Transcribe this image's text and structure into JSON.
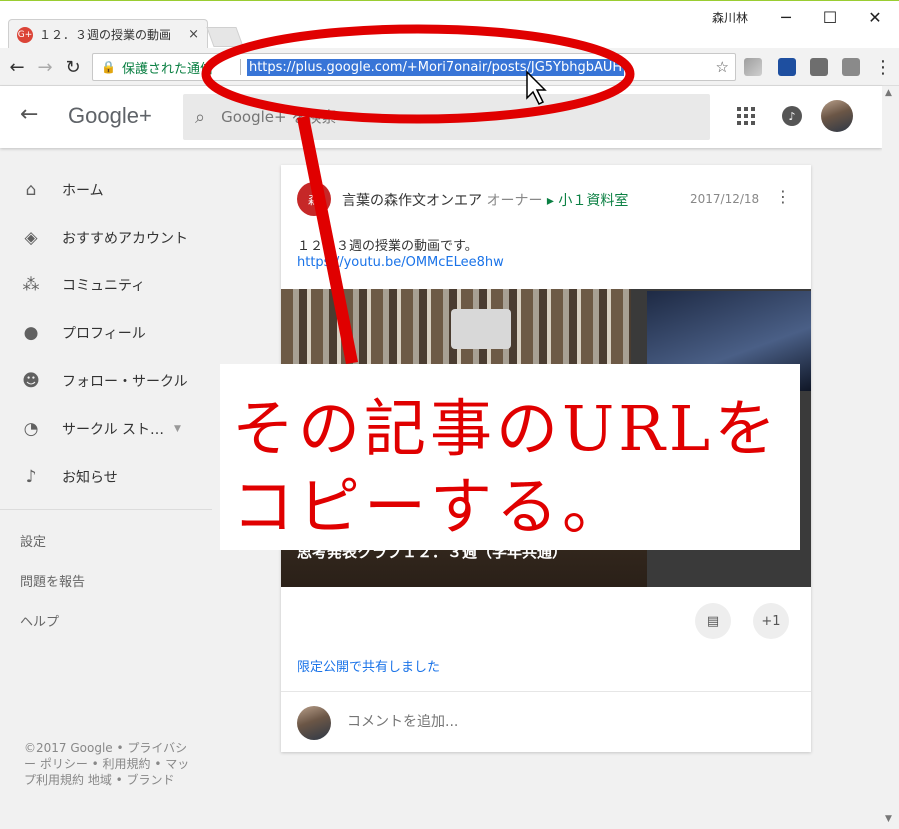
{
  "browser": {
    "tab_title": "１２．３週の授業の動画",
    "tab_close": "×",
    "user": "森川林",
    "min": "─",
    "max": "☐",
    "close": "✕",
    "back": "←",
    "forward": "→",
    "reload": "↻",
    "secure_label": "保護された通信",
    "url": "https://plus.google.com/+Mori7onair/posts/JG5YbhgbAUH",
    "bookmark": "☆"
  },
  "header": {
    "back": "←",
    "logo": "Google+",
    "search_placeholder": "Google+ を検索"
  },
  "sidebar": {
    "items": [
      {
        "label": "ホーム",
        "icon": "⌂"
      },
      {
        "label": "おすすめアカウント",
        "icon": "◈"
      },
      {
        "label": "コミュニティ",
        "icon": "⁂"
      },
      {
        "label": "プロフィール",
        "icon": "●"
      },
      {
        "label": "フォロー・サークル",
        "icon": "☻"
      },
      {
        "label": "サークル スト…",
        "icon": "◔"
      },
      {
        "label": "お知らせ",
        "icon": "♪"
      }
    ],
    "settings": "設定",
    "report": "問題を報告",
    "help": "ヘルプ",
    "footer": "©2017 Google • プライバシー ポリシー • 利用規約 • マップ利用規約 地域 • ブランド"
  },
  "post": {
    "author": "言葉の森作文オンエア",
    "role": "オーナー",
    "collection": "小１資料室",
    "date": "2017/12/18",
    "text": "１２．３週の授業の動画です。",
    "link": "https://youtu.be/OMMcELee8hw",
    "media_caption": "思考発表クラブ１２．３週（学年共通）",
    "plus_one": "+1",
    "share_note": "限定公開で共有しました",
    "comment_placeholder": "コメントを追加..."
  },
  "annotation": {
    "line1": "その記事のURLを",
    "line2": "コピーする。",
    "color": "#e00000"
  }
}
